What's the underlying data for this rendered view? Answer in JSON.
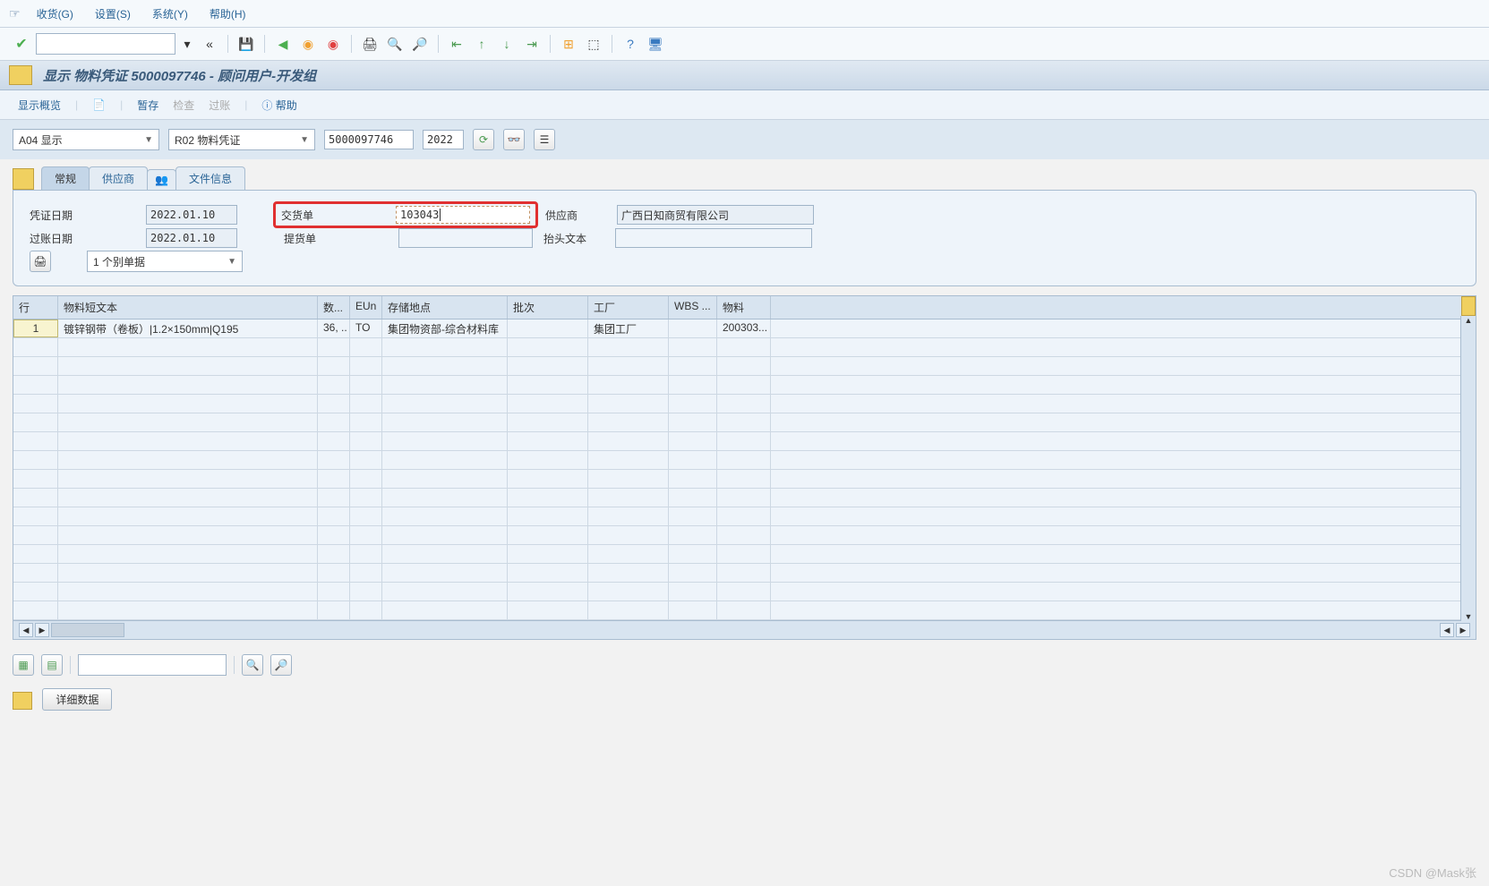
{
  "menu": {
    "arrow": "☞",
    "items": [
      "收货(G)",
      "设置(S)",
      "系统(Y)",
      "帮助(H)"
    ]
  },
  "title": {
    "text": "显示 物料凭证 5000097746 - 顾问用户-开发组"
  },
  "actionbar": {
    "overview": "显示概览",
    "hold": "暂存",
    "check": "检查",
    "post": "过账",
    "help": "帮助"
  },
  "filter": {
    "action": "A04 显示",
    "ref": "R02 物料凭证",
    "doc": "5000097746",
    "year": "2022"
  },
  "tabs": {
    "t1": "常规",
    "t2": "供应商",
    "t3": "",
    "t4": "文件信息"
  },
  "header": {
    "docdate_l": "凭证日期",
    "docdate": "2022.01.10",
    "postdate_l": "过账日期",
    "postdate": "2022.01.10",
    "delivnote_l": "交货单",
    "delivnote": "103043",
    "billoflading_l": "提货单",
    "billoflading": "",
    "vendor_l": "供应商",
    "vendor": "广西日知商贸有限公司",
    "headertext_l": "抬头文本",
    "headertext": "",
    "print": "1 个别单据"
  },
  "grid": {
    "cols": {
      "c0": "行",
      "c1": "物料短文本",
      "c2": "数...",
      "c3": "EUn",
      "c4": "存储地点",
      "c5": "批次",
      "c6": "工厂",
      "c7": "WBS ...",
      "c8": "物料"
    },
    "rows": [
      {
        "c0": "1",
        "c1": "镀锌钢带（卷板）|1.2×150mm|Q195",
        "c2": "36, ..",
        "c3": "TO",
        "c4": "集团物资部-综合材料库",
        "c5": "",
        "c6": "集团工厂",
        "c7": "",
        "c8": "200303..."
      }
    ]
  },
  "detail": {
    "label": "详细数据"
  },
  "watermark": "CSDN @Mask张"
}
